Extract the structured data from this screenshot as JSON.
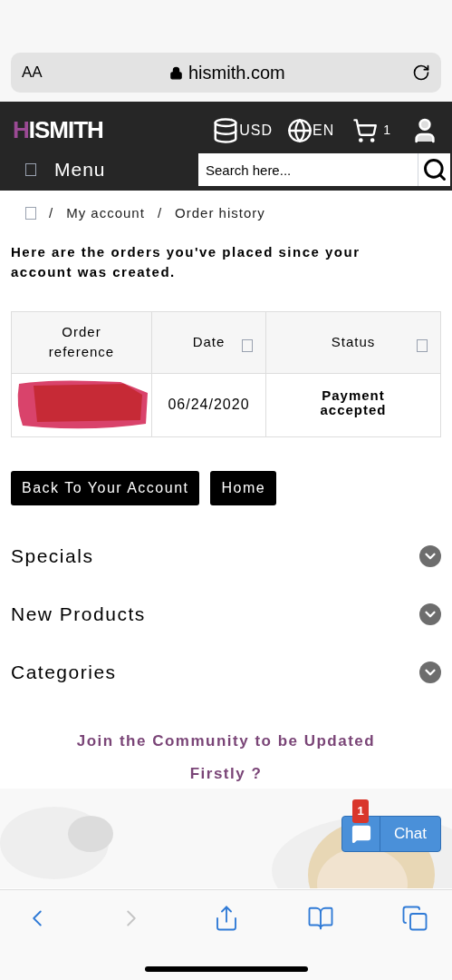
{
  "browser": {
    "text_size": "AA",
    "url": "hismith.com"
  },
  "header": {
    "logo": {
      "accent": "H",
      "rest": "ISMITH"
    },
    "currency": "USD",
    "language": "EN",
    "cart_count": "1",
    "menu": "Menu",
    "search": {
      "placeholder": "Search here..."
    }
  },
  "breadcrumb": [
    {
      "separator": "/",
      "label": "My account"
    },
    {
      "separator": "/",
      "label": "Order history"
    }
  ],
  "intro": "Here are the orders you've placed since your account was created.",
  "table": {
    "columns": [
      {
        "label": "Order reference",
        "sortable": false
      },
      {
        "label": "Date",
        "sortable": true
      },
      {
        "label": "Status",
        "sortable": true
      }
    ],
    "rows": [
      {
        "order_reference": {
          "redacted": true
        },
        "date": "06/24/2020",
        "status": "Payment accepted"
      }
    ]
  },
  "buttons": [
    "Back To Your Account",
    "Home"
  ],
  "sections": [
    {
      "title": "Specials",
      "expanded": false
    },
    {
      "title": "New Products",
      "expanded": false
    },
    {
      "title": "Categories",
      "expanded": false
    }
  ],
  "community": "Join the Community to be Updated Firstly ?",
  "chat": {
    "badge": "1",
    "label": "Chat"
  },
  "toolbar": [
    {
      "kind": "back",
      "disabled": false
    },
    {
      "kind": "forward",
      "disabled": true
    },
    {
      "kind": "share",
      "disabled": false
    },
    {
      "kind": "bookmarks",
      "disabled": false
    },
    {
      "kind": "tabs",
      "disabled": false
    }
  ]
}
